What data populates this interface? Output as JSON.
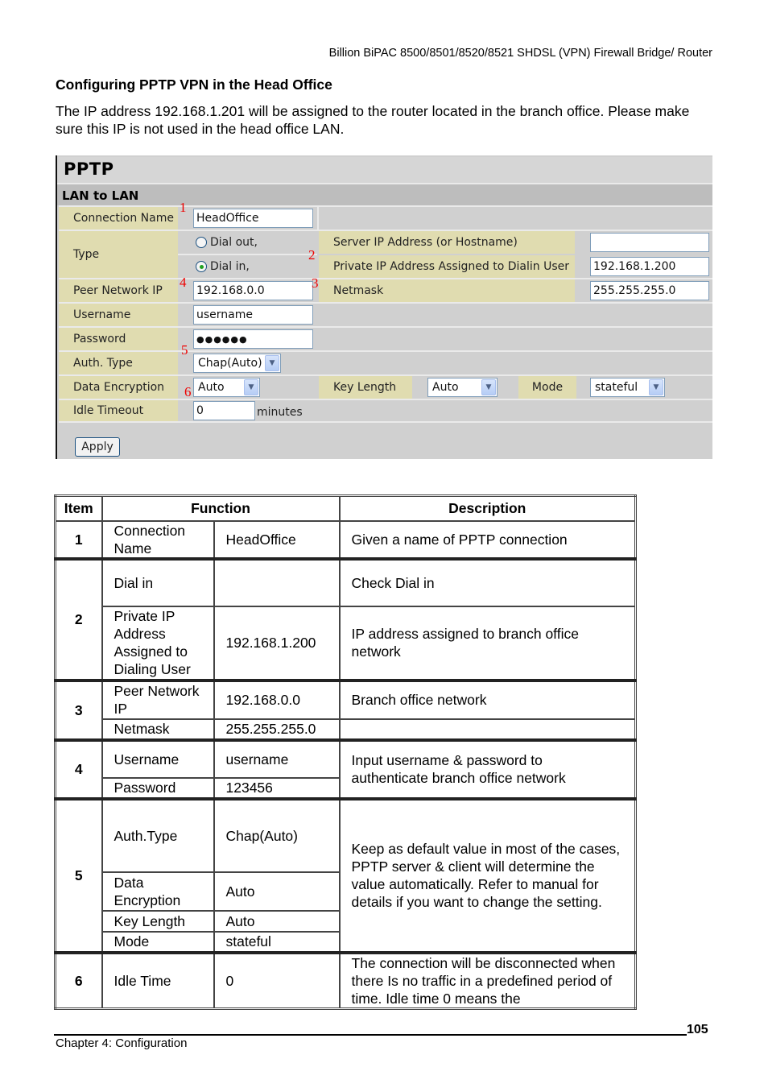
{
  "header": {
    "running_title": "Billion BiPAC 8500/8501/8520/8521 SHDSL (VPN) Firewall Bridge/ Router",
    "section_title": "Configuring PPTP VPN in the Head Office",
    "intro": "The IP address 192.168.1.201 will be assigned to the router located in the branch office. Please make sure this IP is not used in the head office LAN."
  },
  "screenshot": {
    "title": "PPTP",
    "subtitle": "LAN to LAN",
    "fields": {
      "connection_name": {
        "label": "Connection Name",
        "value": "HeadOffice"
      },
      "type": {
        "label": "Type",
        "options": [
          "Dial out,",
          "Dial in,"
        ],
        "selected": "Dial in,"
      },
      "server_ip": {
        "label": "Server IP Address (or Hostname)",
        "value": ""
      },
      "private_ip": {
        "label": "Private IP Address Assigned to Dialin User",
        "value": "192.168.1.200"
      },
      "peer_network_ip": {
        "label": "Peer Network IP",
        "value": "192.168.0.0"
      },
      "netmask": {
        "label": "Netmask",
        "value": "255.255.255.0"
      },
      "username": {
        "label": "Username",
        "value": "username"
      },
      "password": {
        "label": "Password",
        "value": "●●●●●●"
      },
      "auth_type": {
        "label": "Auth. Type",
        "value": "Chap(Auto)"
      },
      "data_encryption": {
        "label": "Data Encryption",
        "value": "Auto"
      },
      "key_length": {
        "label": "Key Length",
        "value": "Auto"
      },
      "mode": {
        "label": "Mode",
        "value": "stateful"
      },
      "idle_timeout": {
        "label": "Idle Timeout",
        "value": "0",
        "unit": "minutes"
      }
    },
    "markers": [
      "1",
      "2",
      "3",
      "4",
      "5",
      "6"
    ],
    "apply_label": "Apply"
  },
  "table": {
    "headers": [
      "Item",
      "Function",
      "Description"
    ],
    "rows": [
      {
        "item": "1",
        "function": "Connection Name",
        "value": "HeadOffice",
        "description": "Given a name of PPTP connection"
      },
      {
        "item": "2",
        "function": "Dial in",
        "value": "",
        "description": "Check Dial in"
      },
      {
        "item": "",
        "function": "Private IP Address Assigned to Dialing User",
        "value": "192.168.1.200",
        "description": "IP address assigned to branch office network"
      },
      {
        "item": "3",
        "function": "Peer Network IP",
        "value": "192.168.0.0",
        "description": "Branch office network"
      },
      {
        "item": "",
        "function": "Netmask",
        "value": "255.255.255.0",
        "description": ""
      },
      {
        "item": "4",
        "function": "Username",
        "value": "username",
        "description": "Input username & password to authenticate branch office network"
      },
      {
        "item": "",
        "function": "Password",
        "value": "123456",
        "description": ""
      },
      {
        "item": "5",
        "function": "Auth.Type",
        "value": "Chap(Auto)",
        "description": "Keep as default value in most of the cases, PPTP server & client will determine the value automatically. Refer to manual for details if you want to change the setting."
      },
      {
        "item": "",
        "function": "Data Encryption",
        "value": "Auto",
        "description": ""
      },
      {
        "item": "",
        "function": "Key Length",
        "value": "Auto",
        "description": ""
      },
      {
        "item": "",
        "function": "Mode",
        "value": "stateful",
        "description": ""
      },
      {
        "item": "6",
        "function": "Idle Time",
        "value": "0",
        "description": "The connection will be disconnected when there Is no traffic in a predefined period of time. Idle time 0 means the"
      }
    ]
  },
  "footer": {
    "page_number": "105",
    "chapter": "Chapter 4: Configuration"
  }
}
